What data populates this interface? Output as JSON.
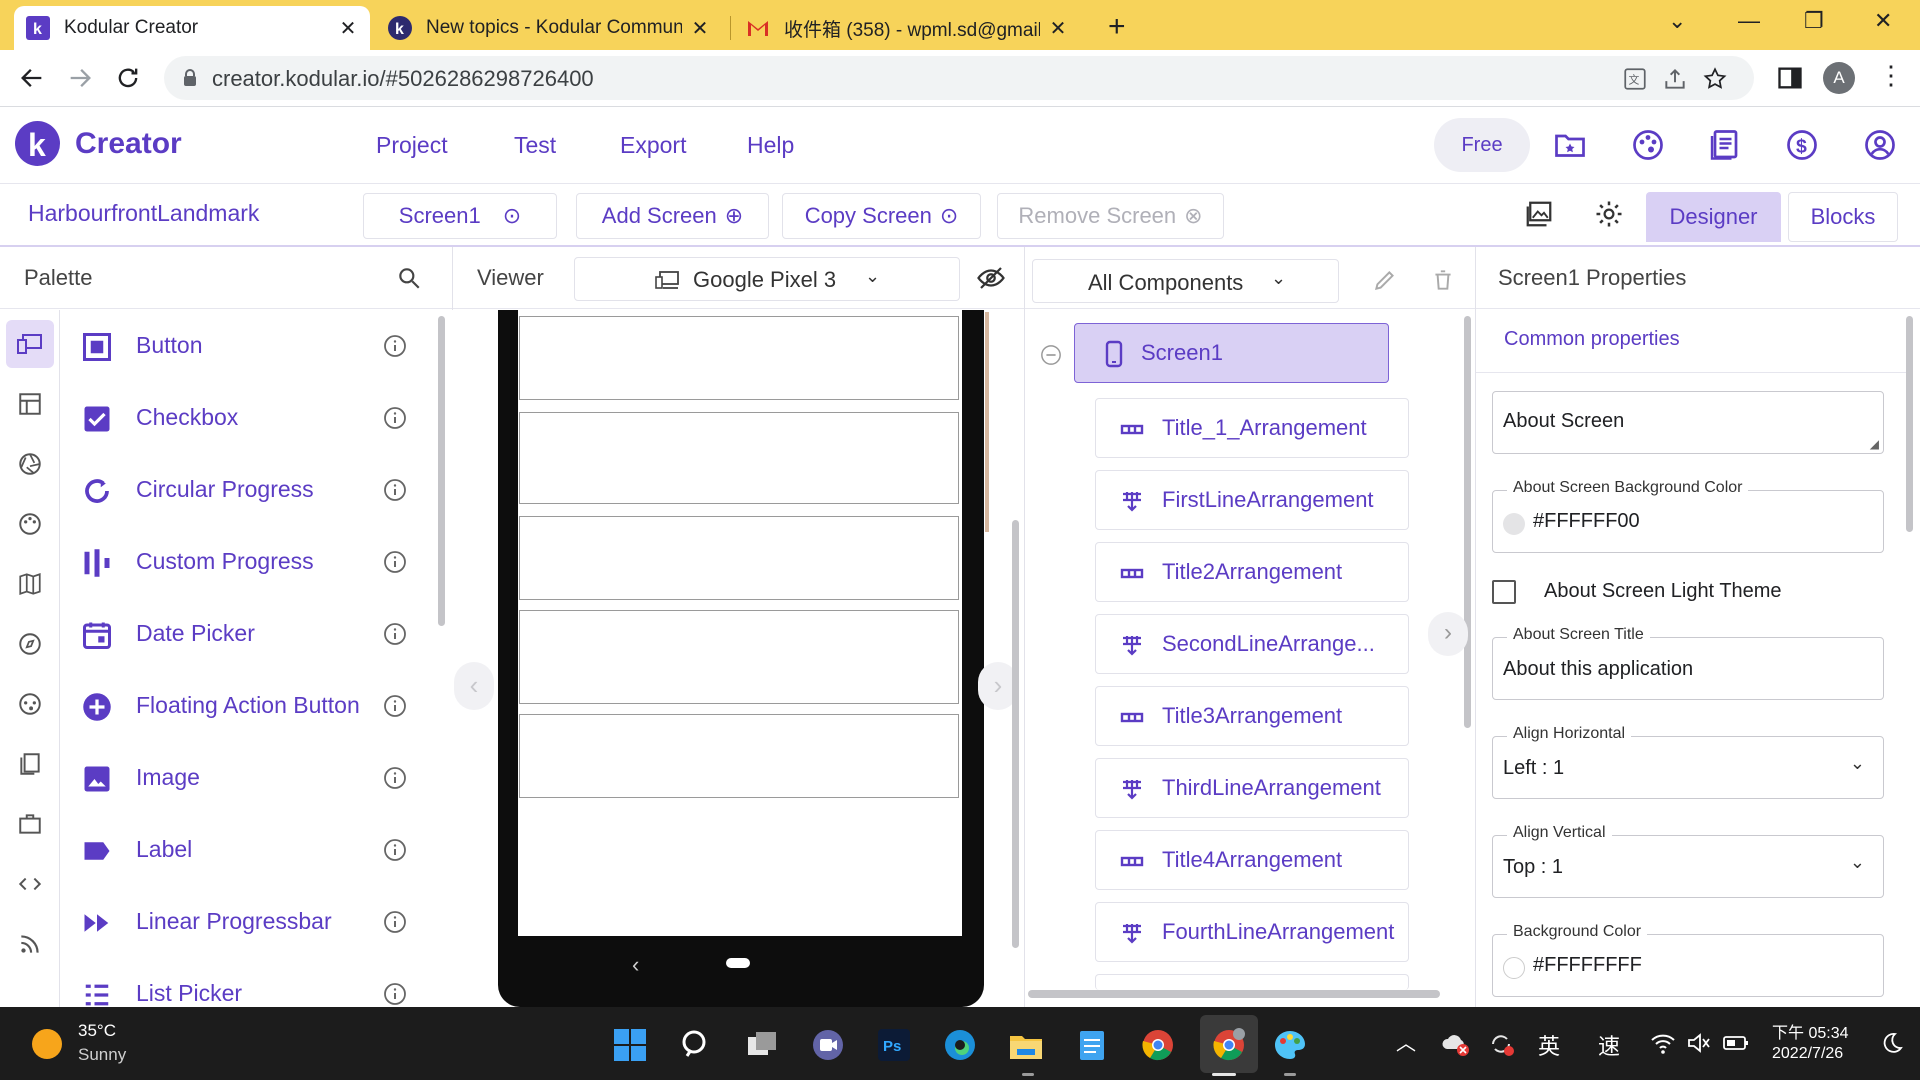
{
  "browser": {
    "tabs": [
      {
        "title": "Kodular Creator",
        "active": true
      },
      {
        "title": "New topics - Kodular Commun",
        "active": false
      },
      {
        "title": "收件箱 (358) - wpml.sd@gmail.",
        "active": false
      }
    ],
    "url": "creator.kodular.io/#5026286298726400",
    "profile_initial": "A",
    "colors": {
      "tabstrip": "#f7d35a",
      "accent": "#5b3cc4"
    }
  },
  "app": {
    "brand": "Creator",
    "menu": [
      "Project",
      "Test",
      "Export",
      "Help"
    ],
    "plan_label": "Free",
    "header_icons": [
      "folder-star-icon",
      "palette-icon",
      "docs-icon",
      "dollar-icon",
      "account-icon"
    ]
  },
  "projectbar": {
    "project_name": "HarbourfrontLandmark",
    "screen_select": "Screen1",
    "add_screen": "Add Screen",
    "copy_screen": "Copy Screen",
    "remove_screen": "Remove Screen",
    "designer": "Designer",
    "blocks": "Blocks"
  },
  "palette": {
    "title": "Palette",
    "items": [
      {
        "label": "Button",
        "icon": "button-icon"
      },
      {
        "label": "Checkbox",
        "icon": "checkbox-icon"
      },
      {
        "label": "Circular Progress",
        "icon": "circular-progress-icon"
      },
      {
        "label": "Custom Progress",
        "icon": "custom-progress-icon"
      },
      {
        "label": "Date Picker",
        "icon": "date-picker-icon"
      },
      {
        "label": "Floating Action Button",
        "icon": "fab-icon"
      },
      {
        "label": "Image",
        "icon": "image-icon"
      },
      {
        "label": "Label",
        "icon": "label-icon"
      },
      {
        "label": "Linear Progressbar",
        "icon": "linear-progressbar-icon"
      },
      {
        "label": "List Picker",
        "icon": "list-picker-icon"
      }
    ]
  },
  "viewer": {
    "title": "Viewer",
    "device": "Google Pixel 3"
  },
  "components": {
    "filter": "All Components",
    "root": "Screen1",
    "children": [
      "Title_1_Arrangement",
      "FirstLineArrangement",
      "Title2Arrangement",
      "SecondLineArrange...",
      "Title3Arrangement",
      "ThirdLineArrangement",
      "Title4Arrangement",
      "FourthLineArrangement"
    ]
  },
  "properties": {
    "title": "Screen1 Properties",
    "section": "Common properties",
    "about_screen": "About Screen",
    "about_bg_label": "About Screen Background Color",
    "about_bg_value": "#FFFFFF00",
    "light_theme_label": "About Screen Light Theme",
    "light_theme_checked": false,
    "about_title_label": "About Screen Title",
    "about_title_value": "About this application",
    "align_h_label": "Align Horizontal",
    "align_h_value": "Left : 1",
    "align_v_label": "Align Vertical",
    "align_v_value": "Top : 1",
    "bg_label": "Background Color",
    "bg_value": "#FFFFFFFF"
  },
  "taskbar": {
    "temperature": "35°C",
    "weather": "Sunny",
    "ime1": "英",
    "ime2": "速",
    "time": "下午 05:34",
    "date": "2022/7/26"
  }
}
